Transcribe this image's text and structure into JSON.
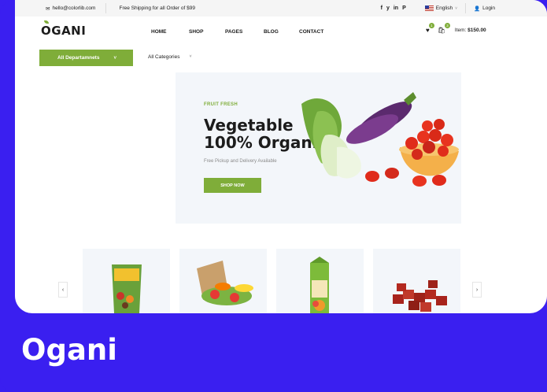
{
  "topbar": {
    "email": "hello@colorlib.com",
    "shipping": "Free Shipping for all Order of $99",
    "social_icons": [
      "facebook-icon",
      "twitter-icon",
      "linkedin-icon",
      "pinterest-icon"
    ],
    "social_glyphs": [
      "f",
      "\u0001F426",
      "in",
      "P"
    ],
    "language": "English",
    "login": "Login"
  },
  "logo": "OGANI",
  "nav": {
    "home": "HOME",
    "shop": "SHOP",
    "pages": "PAGES",
    "blog": "BLOG",
    "contact": "CONTACT"
  },
  "cart": {
    "wishlist_count": "1",
    "cart_count": "3",
    "item_label": "Item:",
    "item_total": "$150.00"
  },
  "departments": {
    "label": "All Departamnets"
  },
  "categories": {
    "label": "All Categories"
  },
  "hero": {
    "kicker": "FRUIT FRESH",
    "title_line1": "Vegetable",
    "title_line2": "100% Organic",
    "subtitle": "Free Pickup and Delivery Available",
    "button": "SHOP NOW"
  },
  "carousel": {
    "prev": "‹",
    "next": "›",
    "products": [
      "fruit-snack-pack",
      "vegetable-bag",
      "juice-carton",
      "diced-meat"
    ]
  },
  "caption": "Ogani",
  "colors": {
    "accent": "#7fad39",
    "frame": "#3a1ff0",
    "hero_bg": "#f3f6fa"
  }
}
